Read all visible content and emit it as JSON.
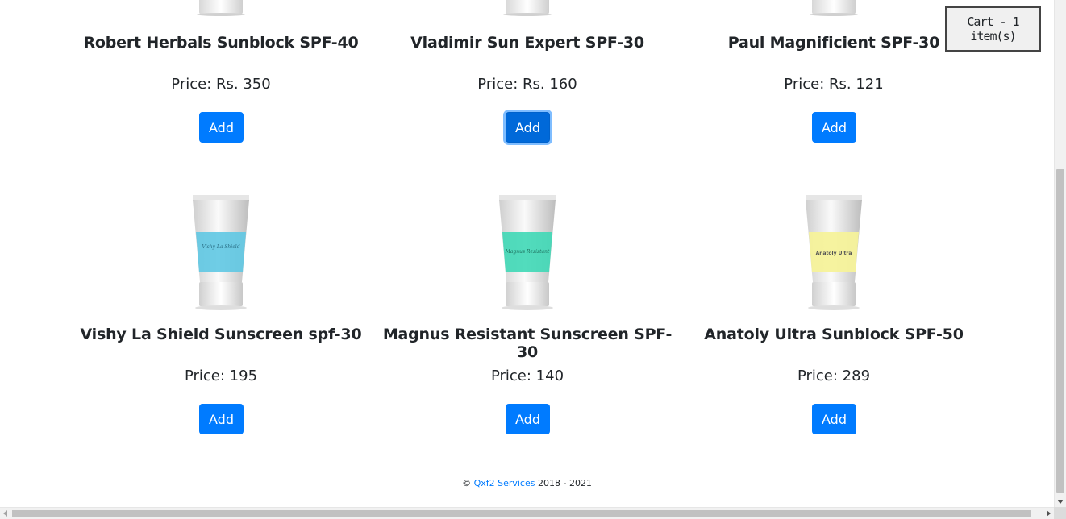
{
  "cart": {
    "label": "Cart - 1 item(s)"
  },
  "products": [
    {
      "name": "Robert Herbals Sunblock SPF-40",
      "price": "Price: Rs. 350",
      "add_label": "Add",
      "band_color": "#ffffff",
      "tube_label": ""
    },
    {
      "name": "Vladimir Sun Expert SPF-30",
      "price": "Price: Rs. 160",
      "add_label": "Add",
      "band_color": "#ffffff",
      "tube_label": ""
    },
    {
      "name": "Paul Magnificient SPF-30",
      "price": "Price: Rs. 121",
      "add_label": "Add",
      "band_color": "#ffffff",
      "tube_label": ""
    },
    {
      "name": "Vishy La Shield Sunscreen spf-30",
      "price": "Price: 195",
      "add_label": "Add",
      "band_color": "#5fc8e3",
      "tube_label": "Vishy La Shield"
    },
    {
      "name": "Magnus Resistant Sunscreen SPF-30",
      "price": "Price: 140",
      "add_label": "Add",
      "band_color": "#3fd8b6",
      "tube_label": "Magnus Resistant"
    },
    {
      "name": "Anatoly Ultra Sunblock SPF-50",
      "price": "Price: 289",
      "add_label": "Add",
      "band_color": "#f6f29a",
      "tube_label": "Anatoly Ultra"
    }
  ],
  "footer": {
    "copyright": "©",
    "link": "Qxf2 Services",
    "years": "2018 - 2021"
  },
  "colors": {
    "primary": "#007bff",
    "text": "#212529"
  }
}
